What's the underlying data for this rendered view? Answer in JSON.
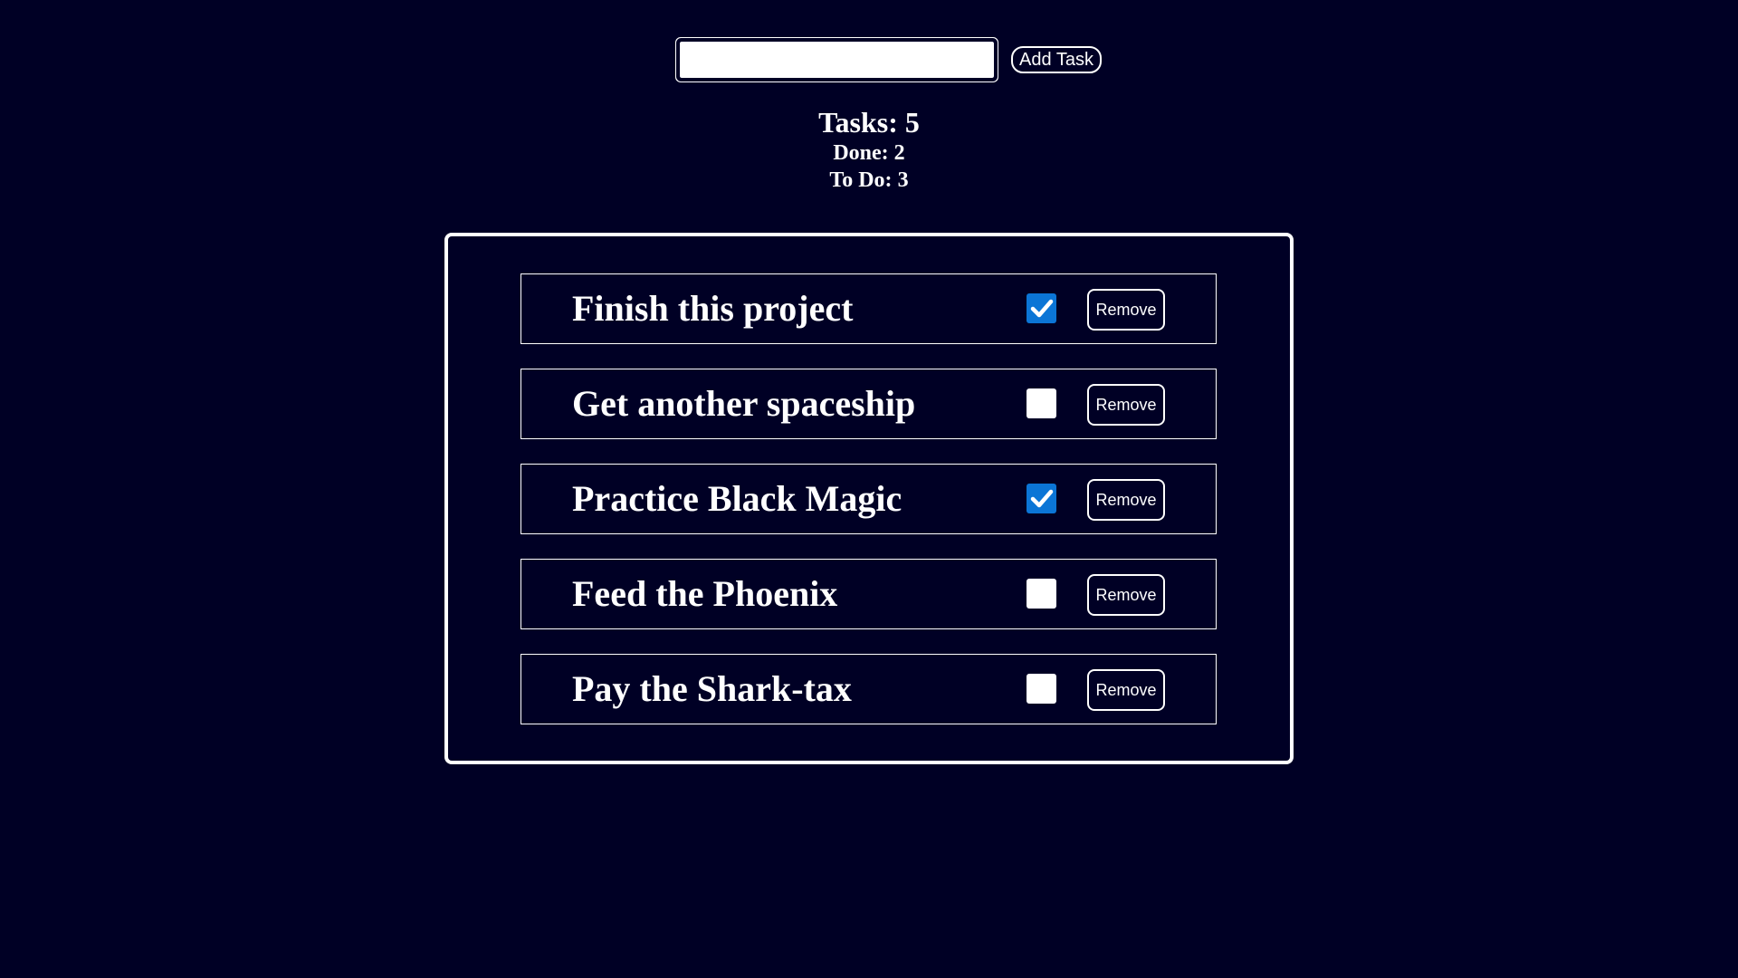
{
  "add_form": {
    "input_value": "",
    "button_label": "Add Task"
  },
  "stats": {
    "total_label": "Tasks:",
    "total_value": "5",
    "done_label": "Done:",
    "done_value": "2",
    "todo_label": "To Do:",
    "todo_value": "3"
  },
  "colors": {
    "background": "#000025",
    "foreground": "#ffffff",
    "checkbox_checked": "#0b75d6"
  },
  "tasks": [
    {
      "name": "Finish this project",
      "done": true,
      "remove_label": "Remove"
    },
    {
      "name": "Get another spaceship",
      "done": false,
      "remove_label": "Remove"
    },
    {
      "name": "Practice Black Magic",
      "done": true,
      "remove_label": "Remove"
    },
    {
      "name": "Feed the Phoenix",
      "done": false,
      "remove_label": "Remove"
    },
    {
      "name": "Pay the Shark-tax",
      "done": false,
      "remove_label": "Remove"
    }
  ]
}
